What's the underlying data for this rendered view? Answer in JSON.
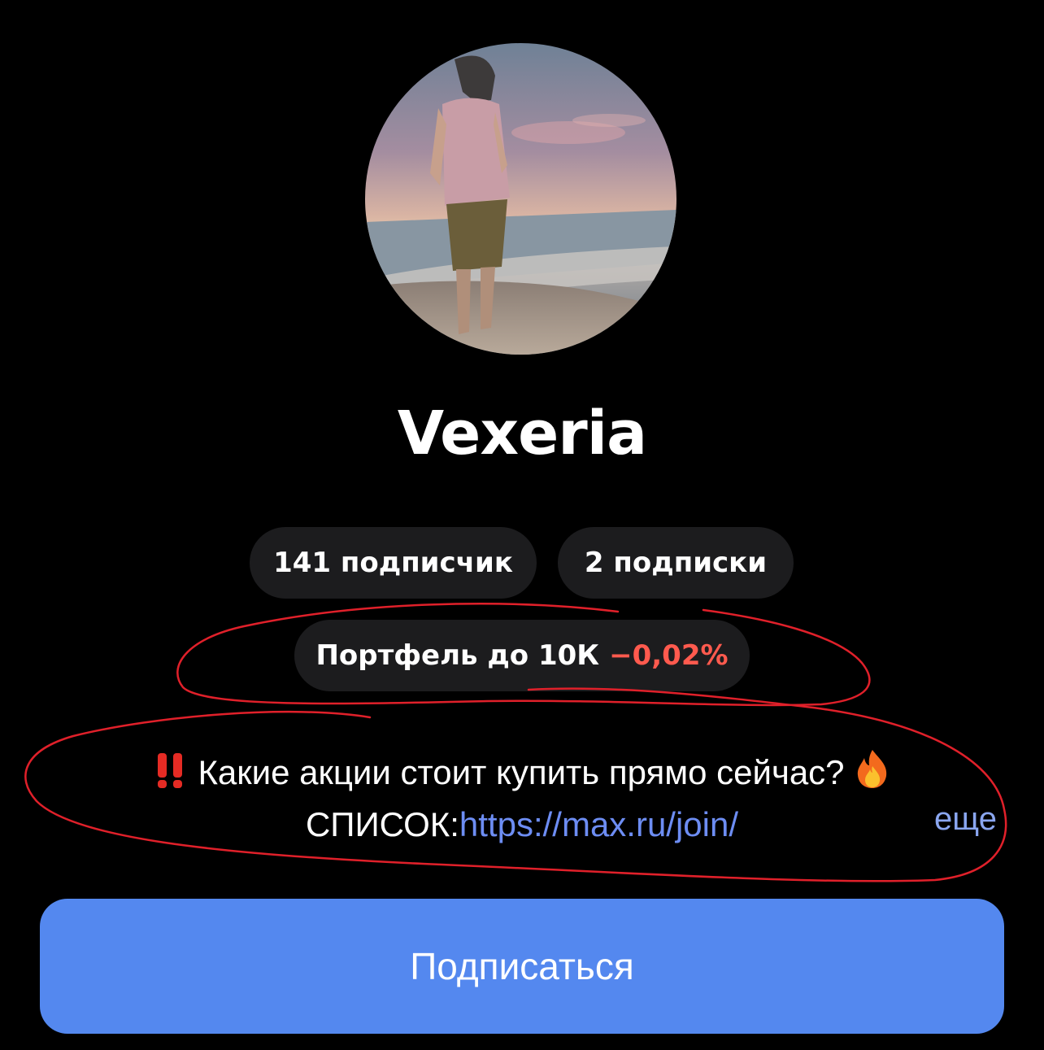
{
  "profile": {
    "name": "Vexeria",
    "followers_label": "141 подписчик",
    "following_label": "2 подписки",
    "portfolio_label": "Портфель до 10К",
    "portfolio_change": "−0,02%",
    "bio_line1": "Какие акции стоит купить прямо сейчас?",
    "bio_prefix": "СПИСОК:",
    "bio_link": "https://max.ru/join/",
    "more_label": "еще",
    "subscribe_label": "Подписаться"
  },
  "icons": {
    "bio_start": "double-exclamation-icon",
    "bio_end": "fire-icon"
  },
  "colors": {
    "background": "#000000",
    "pill_background": "#1c1c1e",
    "negative_change": "#ff5a4e",
    "link": "#6d8df3",
    "subscribe_button": "#5488ef",
    "annotation_marker": "#e0202a"
  }
}
